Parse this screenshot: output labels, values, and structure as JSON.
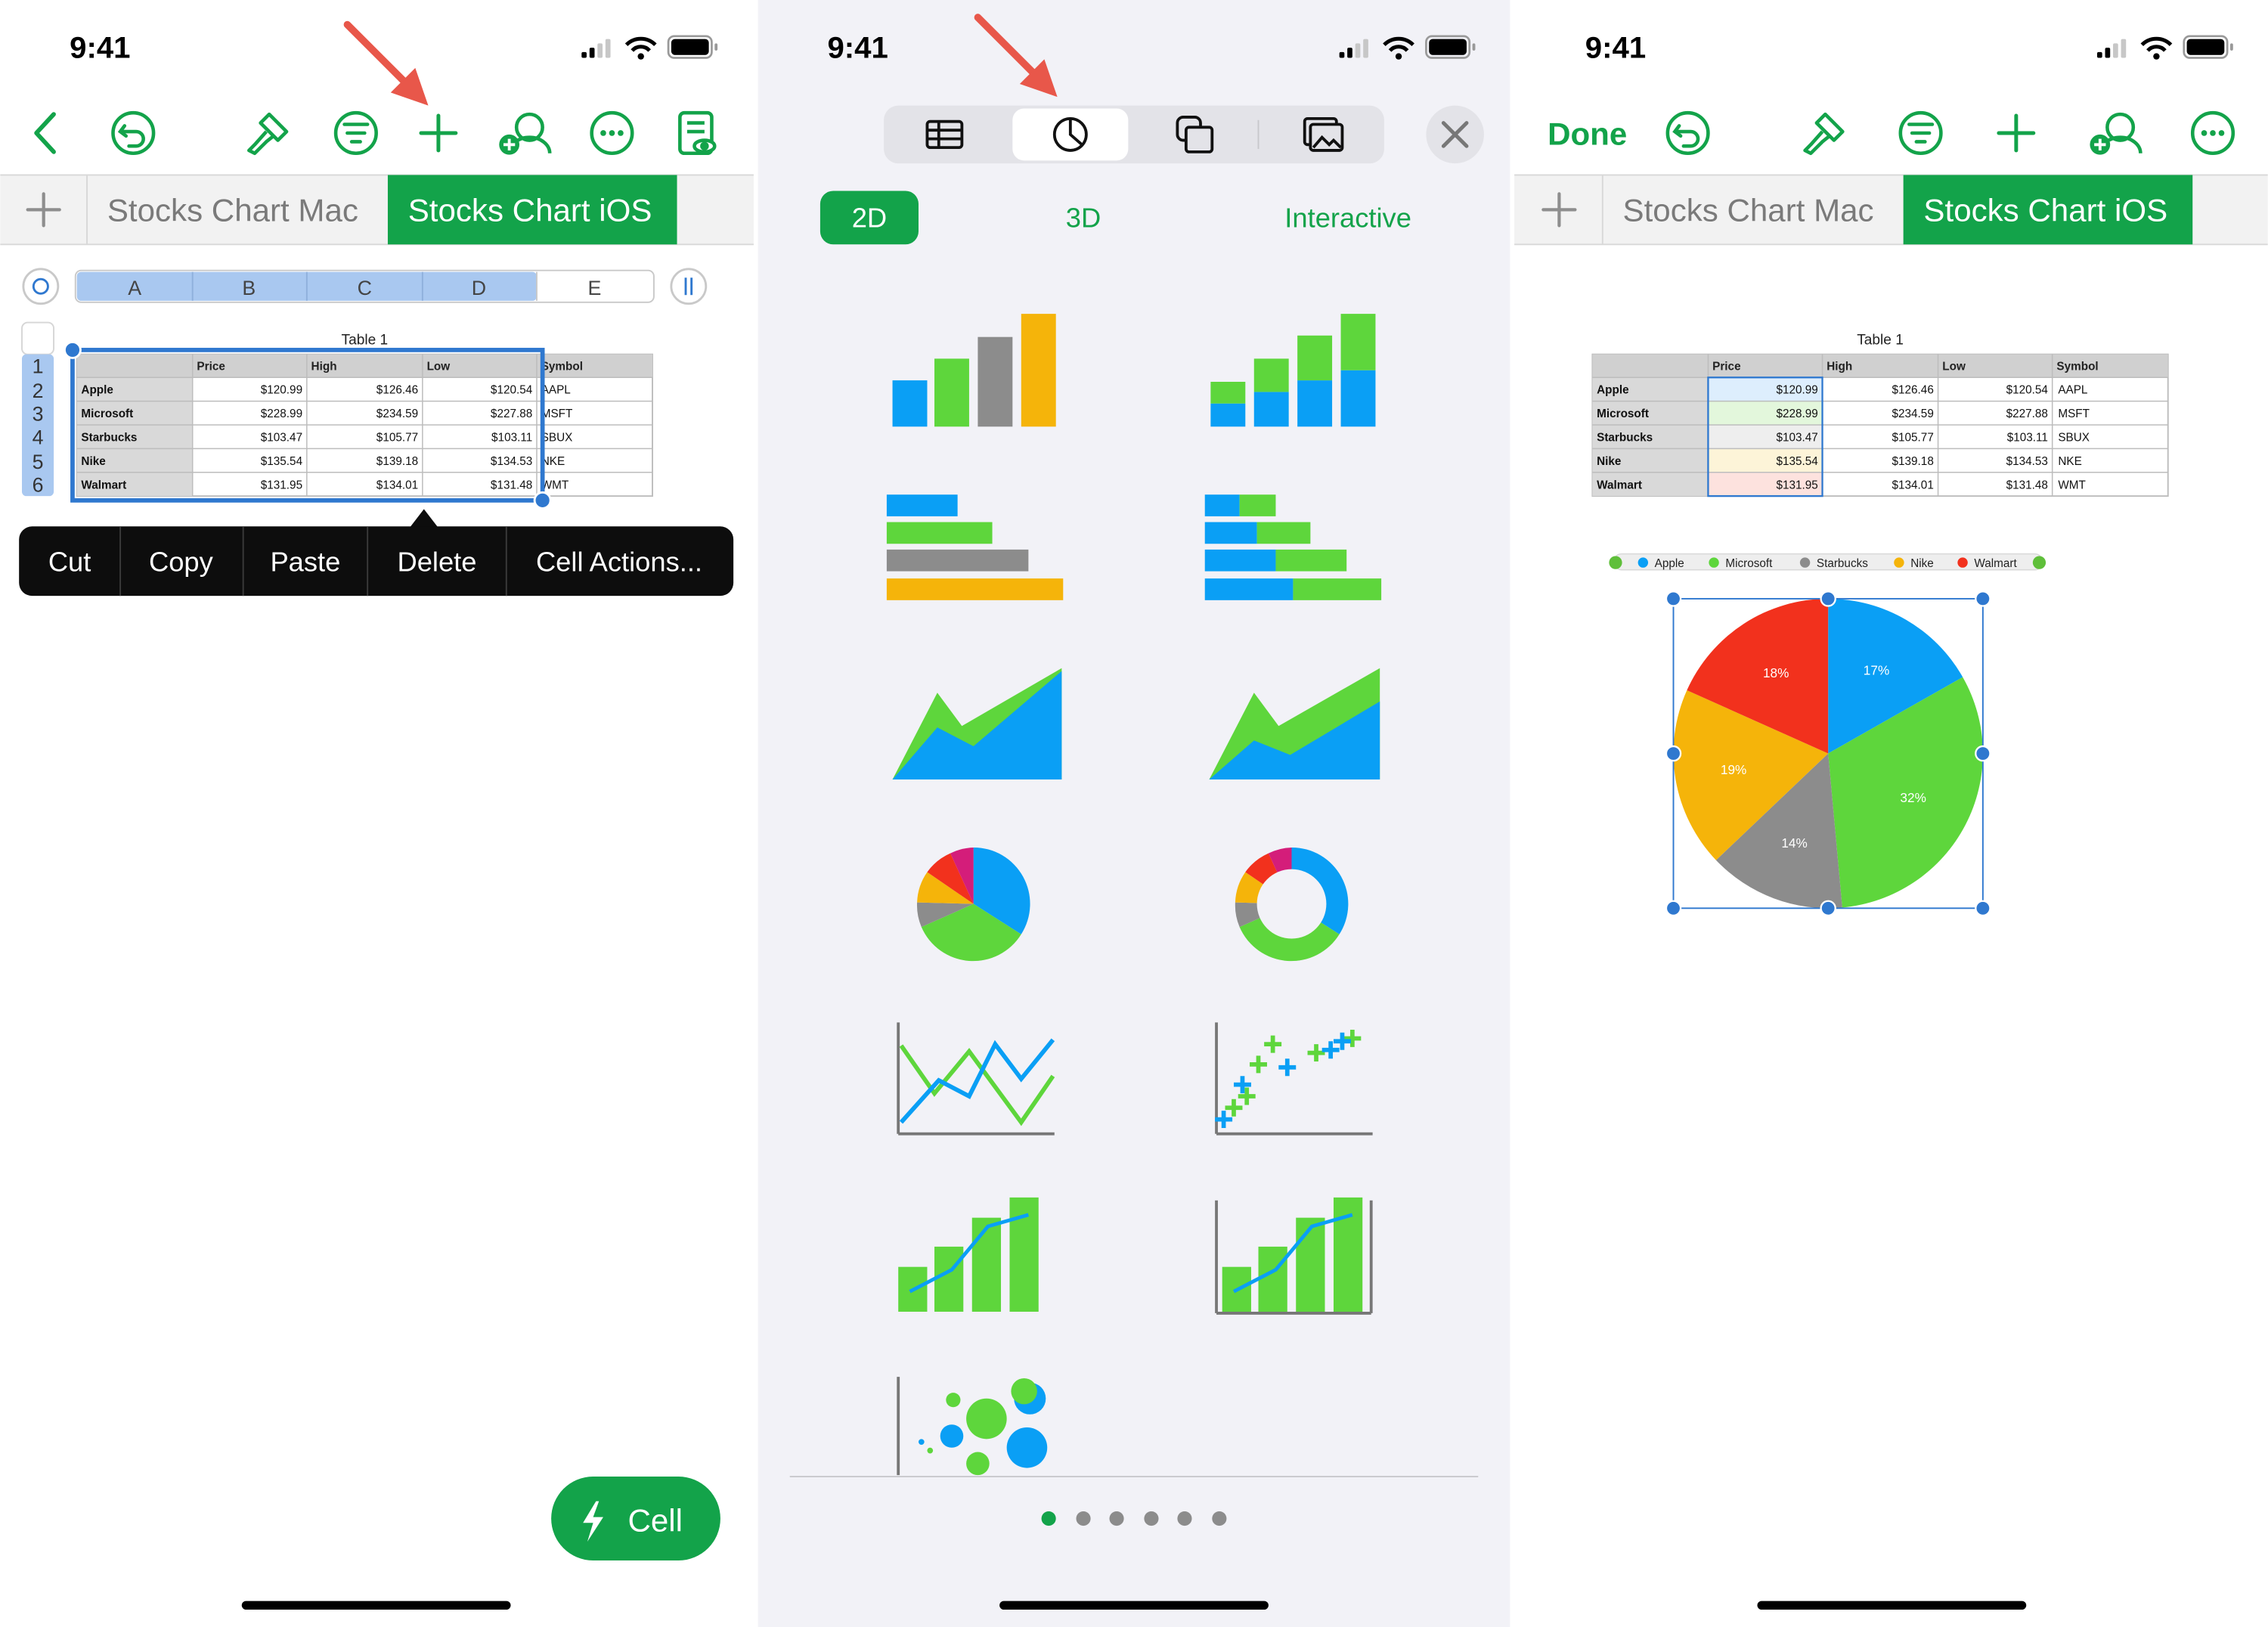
{
  "status_bar": {
    "time": "9:41"
  },
  "panel1": {
    "back_icon": "chevron-left-icon",
    "toolbar_icons": [
      "undo-icon",
      "brush-icon",
      "filter-icon",
      "plus-icon",
      "collaborate-icon",
      "more-icon",
      "reader-view-icon"
    ],
    "sheet_tabs": [
      "Stocks Chart Mac",
      "Stocks Chart iOS"
    ],
    "active_tab": "Stocks Chart iOS",
    "column_letters": [
      "A",
      "B",
      "C",
      "D",
      "E"
    ],
    "row_numbers": [
      "1",
      "2",
      "3",
      "4",
      "5",
      "6"
    ],
    "context_menu": [
      "Cut",
      "Copy",
      "Paste",
      "Delete",
      "Cell Actions..."
    ],
    "cell_button_label": "Cell",
    "arrow_color": "#e8574a"
  },
  "table": {
    "title": "Table 1",
    "headers": [
      "",
      "Price",
      "High",
      "Low",
      "Symbol"
    ],
    "rows": [
      [
        "Apple",
        "$120.99",
        "$126.46",
        "$120.54",
        "AAPL"
      ],
      [
        "Microsoft",
        "$228.99",
        "$234.59",
        "$227.88",
        "MSFT"
      ],
      [
        "Starbucks",
        "$103.47",
        "$105.77",
        "$103.11",
        "SBUX"
      ],
      [
        "Nike",
        "$135.54",
        "$139.18",
        "$134.53",
        "NKE"
      ],
      [
        "Walmart",
        "$131.95",
        "$134.01",
        "$131.48",
        "WMT"
      ]
    ]
  },
  "panel2": {
    "insert_tabs": [
      "table-icon",
      "chart-icon",
      "shape-icon",
      "media-icon"
    ],
    "active_insert_tab": "chart-icon",
    "close_icon": "close-icon",
    "chart_modes": [
      "2D",
      "3D",
      "Interactive"
    ],
    "active_mode": "2D",
    "chart_types": [
      "column",
      "stacked-column",
      "bar",
      "stacked-bar",
      "area",
      "stacked-area",
      "pie",
      "donut",
      "line",
      "scatter",
      "mixed",
      "two-axis",
      "bubble"
    ],
    "page_dots": 6,
    "active_page": 0
  },
  "panel3": {
    "done_label": "Done",
    "toolbar_icons": [
      "undo-icon",
      "brush-icon",
      "filter-icon",
      "plus-icon",
      "collaborate-icon",
      "more-icon"
    ],
    "sheet_tabs": [
      "Stocks Chart Mac",
      "Stocks Chart iOS"
    ],
    "active_tab": "Stocks Chart iOS"
  },
  "chart_data": {
    "type": "pie",
    "legend": [
      "Apple",
      "Microsoft",
      "Starbucks",
      "Nike",
      "Walmart"
    ],
    "colors": [
      "#0a9ff5",
      "#5ed63c",
      "#8c8c8c",
      "#f5b40a",
      "#f2311d"
    ],
    "values": [
      120.99,
      228.99,
      103.47,
      135.54,
      131.95
    ],
    "percent_labels": [
      "17%",
      "32%",
      "14%",
      "19%",
      "18%"
    ],
    "legend_placement": "top"
  },
  "colors": {
    "accent": "#13a34a",
    "selection": "#2f78cf",
    "chart_blue": "#0a9ff5",
    "chart_green": "#5ed63c",
    "chart_gray": "#8c8c8c",
    "chart_yellow": "#f5b40a",
    "chart_red": "#f2311d",
    "chart_magenta": "#d41d7a"
  }
}
